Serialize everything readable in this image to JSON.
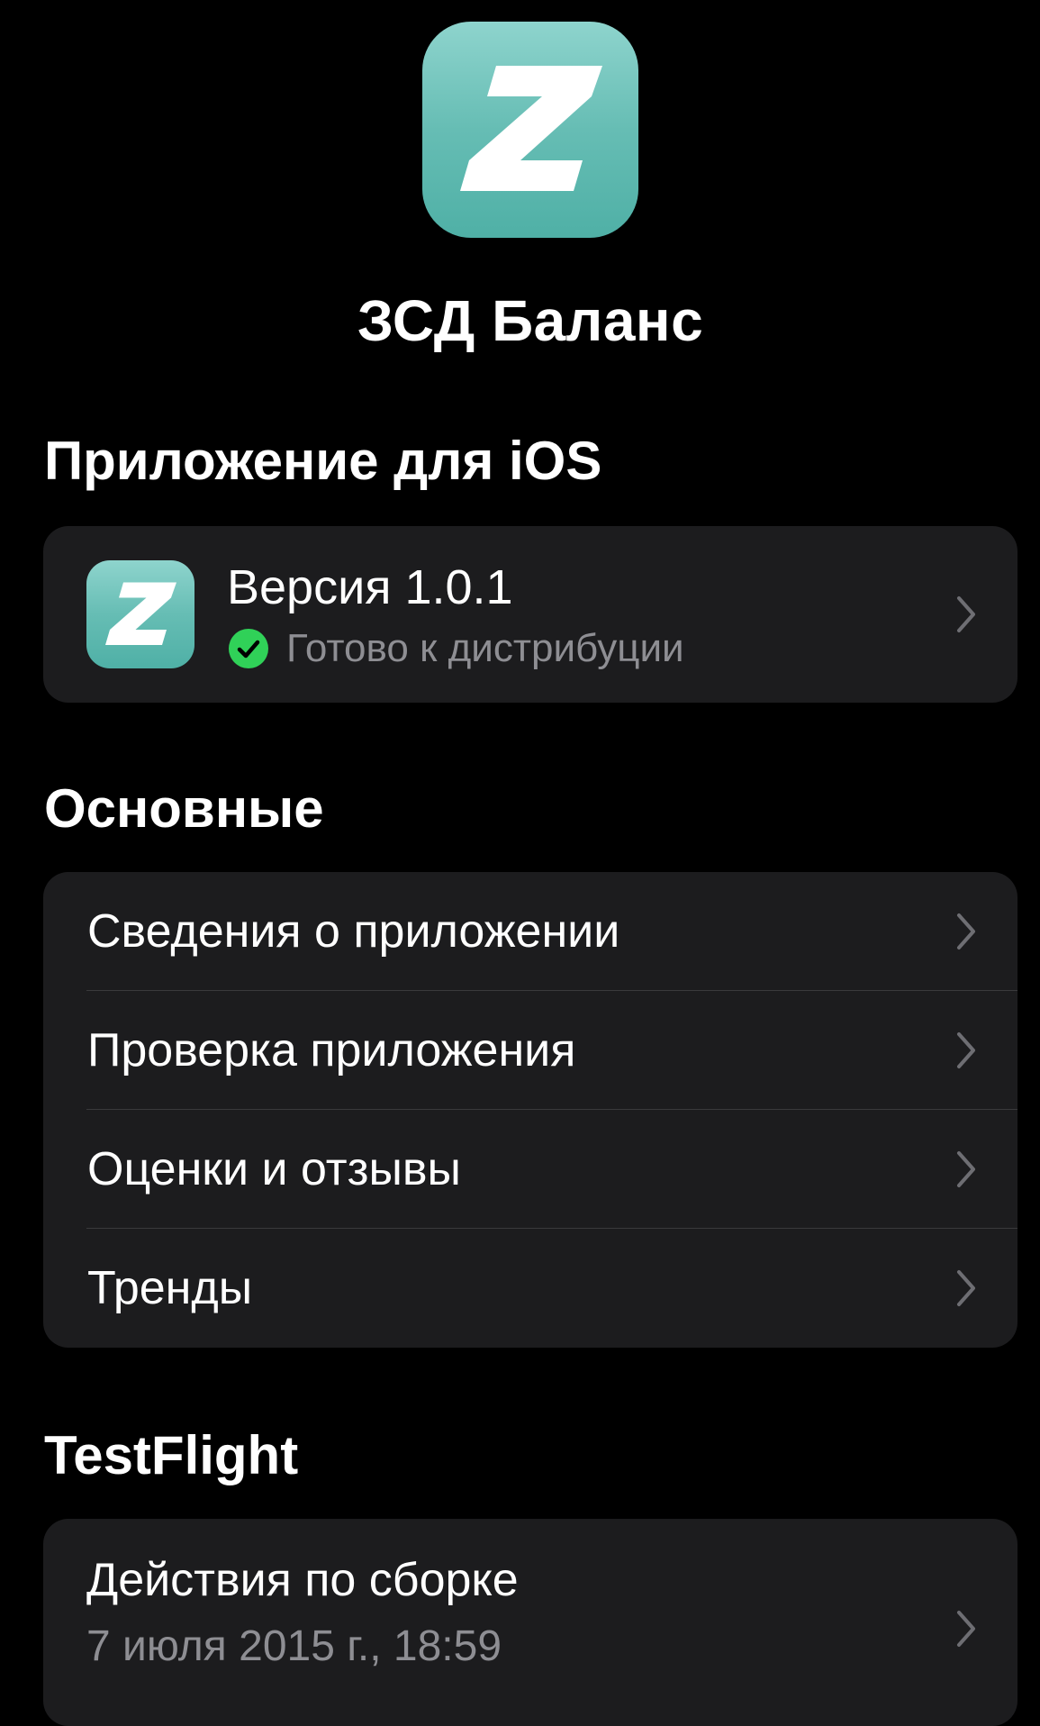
{
  "app": {
    "name": "ЗСД Баланс",
    "icon": "z-letter-app-icon"
  },
  "sections": {
    "ios_app": {
      "header": "Приложение для iOS",
      "version_label": "Версия 1.0.1",
      "status_label": "Готово к дистрибуции",
      "status_icon": "checkmark-circle-icon",
      "status_color": "#30d158"
    },
    "general": {
      "header": "Основные",
      "items": [
        {
          "label": "Сведения о приложении"
        },
        {
          "label": "Проверка приложения"
        },
        {
          "label": "Оценки и отзывы"
        },
        {
          "label": "Тренды"
        }
      ]
    },
    "testflight": {
      "header": "TestFlight",
      "item_title": "Действия по сборке",
      "item_subtitle": "7 июля 2015 г., 18:59"
    }
  },
  "colors": {
    "background": "#000000",
    "card": "#1c1c1e",
    "secondary_text": "#8e8e93",
    "icon_teal": "#66bdb4"
  }
}
